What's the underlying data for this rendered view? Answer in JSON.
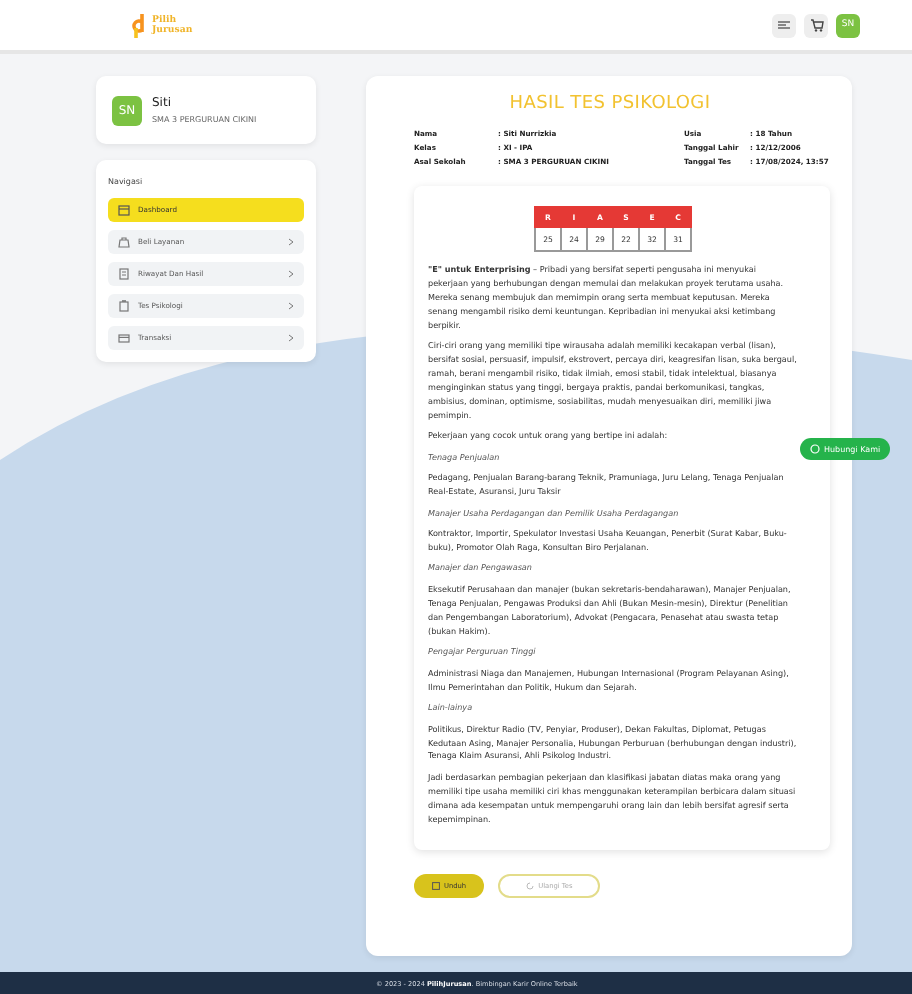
{
  "header": {
    "logo_text": [
      "Pilih",
      "Jurusan"
    ],
    "avatar": "SN"
  },
  "profile": {
    "avatar": "SN",
    "name": "Siti",
    "school": "SMA 3 PERGURUAN CIKINI"
  },
  "navigation": {
    "title": "Navigasi",
    "items": [
      {
        "label": "Dashboard",
        "selected": true
      },
      {
        "label": "Beli Layanan",
        "selected": false
      },
      {
        "label": "Riwayat Dan Hasil",
        "selected": false
      },
      {
        "label": "Tes Psikologi",
        "selected": false
      },
      {
        "label": "Transaksi",
        "selected": false
      }
    ]
  },
  "result": {
    "title": "HASIL TES PSIKOLOGI",
    "info": [
      {
        "label": "Nama",
        "value": ": Siti Nurrizkia"
      },
      {
        "label": "Usia",
        "value": ": 18 Tahun"
      },
      {
        "label": "Kelas",
        "value": ": XI - IPA"
      },
      {
        "label": "Tanggal Lahir",
        "value": ": 12/12/2006"
      },
      {
        "label": "Asal Sekolah",
        "value": ": SMA 3 PERGURUAN CIKINI"
      },
      {
        "label": "Tanggal Tes",
        "value": ": 17/08/2024, 13:57"
      }
    ],
    "scores": [
      {
        "letter": "R",
        "value": "25"
      },
      {
        "letter": "I",
        "value": "24"
      },
      {
        "letter": "A",
        "value": "29"
      },
      {
        "letter": "S",
        "value": "22"
      },
      {
        "letter": "E",
        "value": "32"
      },
      {
        "letter": "C",
        "value": "31"
      }
    ],
    "paragraphs": [
      {
        "kind": "text",
        "text": "**\"E\" untuk Enterprising** – Pribadi yang bersifat seperti pengusaha ini menyukai pekerjaan yang berhubungan dengan memulai dan melakukan proyek terutama usaha. Mereka senang membujuk dan memimpin orang serta membuat keputusan. Mereka senang mengambil risiko demi keuntungan. Kepribadian ini menyukai aksi ketimbang berpikir."
      },
      {
        "kind": "text",
        "text": "Ciri-ciri orang yang memiliki tipe wirausaha adalah memiliki kecakapan verbal (lisan), bersifat sosial, persuasif, impulsif, ekstrovert, percaya diri, keagresifan lisan, suka bergaul, ramah, berani mengambil risiko, tidak ilmiah, emosi stabil, tidak intelektual, biasanya menginginkan status yang tinggi, bergaya praktis, pandai berkomunikasi, tangkas, ambisius, dominan, optimisme, sosiabilitas, mudah menyesuaikan diri, memiliki jiwa pemimpin."
      },
      {
        "kind": "text",
        "text": "Pekerjaan yang cocok untuk orang yang bertipe ini adalah:"
      },
      {
        "kind": "heading",
        "text": "Tenaga Penjualan"
      },
      {
        "kind": "text",
        "text": "Pedagang, Penjualan Barang-barang Teknik, Pramuniaga, Juru Lelang, Tenaga Penjualan Real-Estate, Asuransi, Juru Taksir"
      },
      {
        "kind": "heading",
        "text": "Manajer Usaha Perdagangan dan Pemilik Usaha Perdagangan"
      },
      {
        "kind": "text",
        "text": "Kontraktor, Importir, Spekulator Investasi Usaha Keuangan, Penerbit (Surat Kabar, Buku-buku), Promotor Olah Raga, Konsultan Biro Perjalanan."
      },
      {
        "kind": "heading",
        "text": "Manajer dan Pengawasan"
      },
      {
        "kind": "text",
        "text": "Eksekutif Perusahaan dan manajer (bukan sekretaris-bendaharawan), Manajer Penjualan, Tenaga Penjualan, Pengawas Produksi dan Ahli (Bukan Mesin-mesin), Direktur (Penelitian dan Pengembangan Laboratorium), Advokat (Pengacara, Penasehat atau swasta tetap (bukan Hakim)."
      },
      {
        "kind": "heading",
        "text": "Pengajar Perguruan Tinggi"
      },
      {
        "kind": "text",
        "text": "Administrasi Niaga dan Manajemen, Hubungan Internasional (Program Pelayanan Asing), Ilmu Pemerintahan dan Politik, Hukum dan Sejarah."
      },
      {
        "kind": "heading",
        "text": "Lain-lainya"
      },
      {
        "kind": "text",
        "text": "Politikus, Direktur Radio (TV, Penyiar, Produser), Dekan Fakultas, Diplomat, Petugas Kedutaan Asing, Manajer Personalia, Hubungan Perburuan (berhubungan dengan industri), Tenaga Klaim Asuransi, Ahli Psikolog Industri."
      },
      {
        "kind": "text",
        "text": "Jadi berdasarkan pembagian pekerjaan dan klasifikasi jabatan diatas maka orang yang memiliki tipe usaha memiliki ciri khas menggunakan keterampilan berbicara dalam situasi dimana ada kesempatan untuk mempengaruhi orang lain dan lebih bersifat agresif serta kepemimpinan."
      }
    ],
    "buttons": [
      {
        "kind": "primary",
        "label": "Unduh"
      },
      {
        "kind": "outline",
        "label": "Ulangi Tes"
      }
    ]
  },
  "contact_button": "Hubungi Kami",
  "footer": {
    "text": "© 2023 - 2024 **PilihJurusan**. Bimbingan Karir Online Terbaik"
  }
}
